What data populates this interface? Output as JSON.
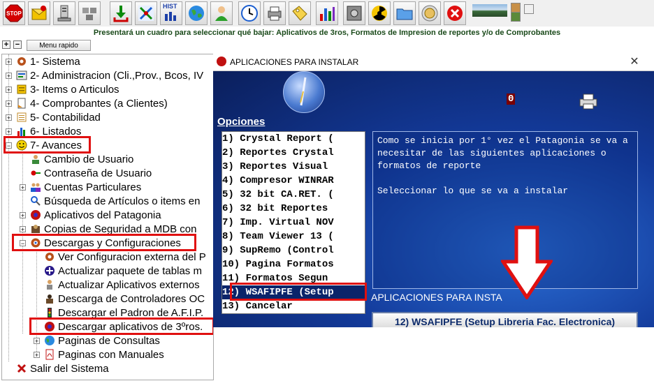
{
  "toolbar": {
    "buttons": [
      "stop-icon",
      "mail-icon",
      "computer-icon",
      "network-icon",
      "download-icon",
      "tools-icon",
      "hist-icon",
      "earth-icon",
      "user-icon",
      "clock-icon",
      "printer-icon",
      "tag-icon",
      "chart-icon",
      "safe-icon",
      "radiation-icon",
      "folder-icon",
      "coin-icon",
      "close-icon"
    ],
    "hist_label": "HIST"
  },
  "hint": "Presentará un cuadro para seleccionar qué bajar: Aplicativos de 3ros, Formatos de Impresion de reportes y/o de Comprobantes",
  "quick": {
    "plus": "+",
    "minus": "−",
    "menu_label": "Menu rapido"
  },
  "tree": {
    "items": [
      {
        "label": "1- Sistema",
        "icon": "gear-icon"
      },
      {
        "label": "2- Administracion (Cli.,Prov., Bcos, IV",
        "icon": "admin-icon"
      },
      {
        "label": "3- Items o Articulos",
        "icon": "items-icon"
      },
      {
        "label": "4- Comprobantes (a Clientes)",
        "icon": "document-icon"
      },
      {
        "label": "5- Contabilidad",
        "icon": "ledger-icon"
      },
      {
        "label": "6- Listados",
        "icon": "chart-icon"
      },
      {
        "label": "7- Avances",
        "icon": "smiley-icon"
      },
      {
        "label": "Cambio de Usuario",
        "icon": "user-switch-icon"
      },
      {
        "label": "Contraseña de Usuario",
        "icon": "key-icon"
      },
      {
        "label": "Cuentas Particulares",
        "icon": "people-icon"
      },
      {
        "label": "Búsqueda de Artículos o items  en",
        "icon": "search-icon"
      },
      {
        "label": "Aplicativos del Patagonia",
        "icon": "app-icon"
      },
      {
        "label": "Copias de Seguridad a MDB con",
        "icon": "backup-icon"
      },
      {
        "label": "Descargas y Configuraciones",
        "icon": "config-icon"
      },
      {
        "label": "Ver Configuracion externa del P",
        "icon": "gear-icon"
      },
      {
        "label": "Actualizar paquete de tablas m",
        "icon": "update-icon"
      },
      {
        "label": "Actualizar Aplicativos externos",
        "icon": "person-icon"
      },
      {
        "label": "Descarga de Controladores OC",
        "icon": "driver-icon"
      },
      {
        "label": "Descargar el Padron de A.F.I.P.",
        "icon": "traffic-light-icon"
      },
      {
        "label": "Descargar aplicativos de 3ºros.",
        "icon": "app-icon"
      },
      {
        "label": "Paginas de Consultas",
        "icon": "globe-icon"
      },
      {
        "label": "Paginas con Manuales",
        "icon": "pdf-icon"
      },
      {
        "label": "Salir del Sistema",
        "icon": "exit-icon"
      }
    ]
  },
  "dialog": {
    "title": "APLICACIONES PARA INSTALAR",
    "close_glyph": "✕",
    "opciones_label": "Opciones",
    "counter": "0",
    "options": [
      "1) Crystal Report (",
      "2) Reportes Crystal",
      "3) Reportes Visual",
      "4) Compresor WINRAR",
      "5) 32 bit CA.RET. (",
      "6) 32 bit Reportes",
      "7) Imp. Virtual NOV",
      "8) Team Viewer 13 (",
      "9) SupRemo (Control",
      "10) Pagina Formatos",
      "11) Formatos Segun",
      "12) WSAFIPFE (Setup",
      "13) Cancelar"
    ],
    "selected_index": 11,
    "description": "Como se inicia por 1° vez el Patagonia se va a necesitar de las siguientes aplicaciones o formatos de reporte\n\nSeleccionar lo que se va a instalar",
    "caption": "APLICACIONES PARA INSTA",
    "selected_button": "12) WSAFIPFE (Setup Libreria Fac. Electronica)"
  },
  "colors": {
    "highlight_red": "#e01010",
    "dialog_blue": "#1b3a8a",
    "selection_blue": "#0a246a"
  }
}
